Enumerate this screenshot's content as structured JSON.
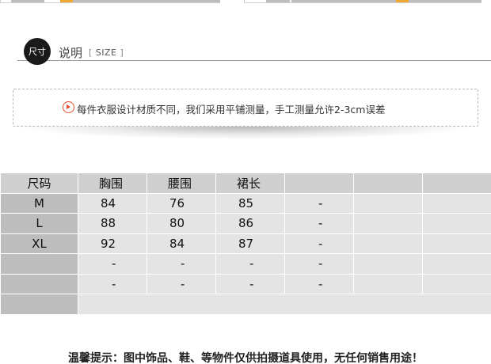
{
  "header": {
    "badge_text": "尺寸",
    "title": "说明",
    "subtitle_open": "[",
    "subtitle": "SIZE",
    "subtitle_close": "]"
  },
  "notice": {
    "icon": "arrow-circle-icon",
    "icon_color": "#e84a2e",
    "text": "每件衣服设计材质不同，我们采用平铺测量，手工测量允许2-3cm误差"
  },
  "table": {
    "columns": [
      "尺码",
      "胸围",
      "腰围",
      "裙长",
      "",
      "",
      ""
    ],
    "rows": [
      [
        "M",
        "84",
        "76",
        "85",
        "-",
        "",
        ""
      ],
      [
        "L",
        "88",
        "80",
        "86",
        "-",
        "",
        ""
      ],
      [
        "XL",
        "92",
        "84",
        "87",
        "-",
        "",
        ""
      ],
      [
        "",
        "-",
        "-",
        "-",
        "-",
        "",
        ""
      ],
      [
        "",
        "-",
        "-",
        "-",
        "-",
        "",
        ""
      ],
      [
        "",
        "",
        "",
        "",
        "",
        "",
        ""
      ]
    ]
  },
  "footer": {
    "text": "温馨提示：图中饰品、鞋、等物件仅供拍摄道具使用，无任何销售用途！"
  }
}
